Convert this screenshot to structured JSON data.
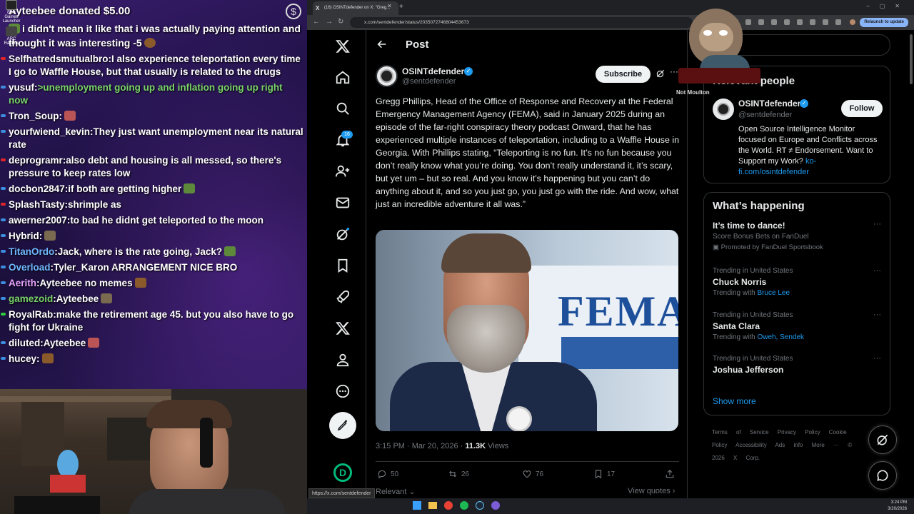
{
  "chat": {
    "donation": {
      "user": "Ayteebee",
      "text": " donated $5.00"
    },
    "donation_message": "i didn't mean it like that i was actually paying attention and thought it was interesting -5",
    "lines": [
      {
        "user": "Selfhatredsmutualbro",
        "sep": ":",
        "text": "I also experience teleportation every time I go to Waffle House, but that usually is related to the drugs",
        "user_color": "#ffffff",
        "dot": "#e0242a",
        "text_color": "#ffffff"
      },
      {
        "user": "yusuf",
        "sep": ":",
        "text": ">unemployment going up and inflation going up right now",
        "user_color": "#ffffff",
        "dot": "#3c8de0",
        "text_color": "#7ad36a"
      },
      {
        "user": "Tron_Soup",
        "sep": ":",
        "text": "",
        "user_color": "#ffffff",
        "dot": "#3c8de0",
        "text_color": "#ffffff"
      },
      {
        "user": "yourfwiend_kevin",
        "sep": ":",
        "text": "They just want unemployment near its natural rate",
        "user_color": "#ffffff",
        "dot": "#3c8de0",
        "text_color": "#ffffff"
      },
      {
        "user": "deprogramr",
        "sep": ":",
        "text": "also debt and housing is all messed, so there's pressure to keep rates low",
        "user_color": "#ffffff",
        "dot": "#e0242a",
        "text_color": "#ffffff"
      },
      {
        "user": "docbon2847",
        "sep": ":",
        "text": "if both are getting higher",
        "user_color": "#ffffff",
        "dot": "#3c8de0",
        "text_color": "#ffffff"
      },
      {
        "user": "SplashTasty",
        "sep": ":",
        "text": "shrimple as",
        "user_color": "#ffffff",
        "dot": "#e0242a",
        "text_color": "#ffffff"
      },
      {
        "user": "awerner2007",
        "sep": ":",
        "text": "to bad he didnt get teleported to the moon",
        "user_color": "#ffffff",
        "dot": "#3c8de0",
        "text_color": "#ffffff"
      },
      {
        "user": "Hybrid",
        "sep": ":",
        "text": "",
        "user_color": "#ffffff",
        "dot": "#3c8de0",
        "text_color": "#ffffff"
      },
      {
        "user": "TitanOrdo",
        "sep": ":",
        "text": "Jack, where is the rate going, Jack?",
        "user_color": "#6fb8ff",
        "dot": "#3c8de0",
        "text_color": "#ffffff"
      },
      {
        "user": "Overload",
        "sep": ":",
        "text": "Tyler_Karon ARRANGEMENT NICE BRO",
        "user_color": "#6fb8ff",
        "dot": "#3c8de0",
        "text_color": "#ffffff"
      },
      {
        "user": "Aerith",
        "sep": ":",
        "text": "Ayteebee",
        "suffix": " no memes",
        "user_color": "#e8a3ff",
        "dot": "#3c8de0",
        "text_color": "#ffffff"
      },
      {
        "user": "gamezoid",
        "sep": ":",
        "text": "Ayteebee",
        "user_color": "#7ad36a",
        "dot": "#3c8de0",
        "text_color": "#ffffff"
      },
      {
        "user": "RoyalRab",
        "sep": ":",
        "text": "make the retirement age 45. but you also have to go fight for Ukraine",
        "user_color": "#ffffff",
        "dot": "#2ecc40",
        "text_color": "#ffffff"
      },
      {
        "user": "diluted",
        "sep": ":",
        "text": "Ayteebee",
        "user_color": "#ffffff",
        "dot": "#3c8de0",
        "text_color": "#ffffff"
      },
      {
        "user": "hucey",
        "sep": ":",
        "text": "",
        "user_color": "#ffffff",
        "dot": "#3c8de0",
        "text_color": "#ffffff"
      }
    ]
  },
  "desktop_icons": [
    "Epic Games Launcher",
    "ARC Raiders"
  ],
  "browser": {
    "tab_title": "(16) OSINTdefender on X: \"Greg...",
    "url": "x.com/sentdefender/status/2035072746804453673",
    "relaunch": "Relaunch to update",
    "status_url": "https://x.com/sentdefender"
  },
  "x_nav": {
    "notification_count": "16"
  },
  "post": {
    "header": "Post",
    "author_name": "OSINTdefender",
    "author_handle": "@sentdefender",
    "subscribe": "Subscribe",
    "text": "Gregg Phillips, Head of the Office of Response and Recovery at the Federal Emergency Management Agency (FEMA), said in January 2025 during an episode of the far-right conspiracy theory podcast Onward, that he has experienced multiple instances of teleportation, including to a Waffle House in Georgia. With Phillips stating, “Teleporting is no fun. It’s no fun because you don’t really know what you’re doing. You don’t really understand it, it’s scary, but yet um – but so real. And you know it’s happening but you can’t do anything about it, and so you just go, you just go with the ride. And wow, what just an incredible adventure it all was.”",
    "image_text": "FEMA",
    "time": "3:15 PM · Mar 20, 2026 · ",
    "views_count": "11.3K",
    "views_label": " Views",
    "replies": "50",
    "reposts": "26",
    "likes": "76",
    "bookmarks": "17",
    "relevant": "Relevant",
    "view_quotes": "View quotes"
  },
  "sidebar": {
    "relevant_title": "Relevant people",
    "person": {
      "name": "OSINTdefender",
      "handle": "@sentdefender",
      "follow": "Follow",
      "bio": "Open Source Intelligence Monitor focused on Europe and Conflicts across the World. RT ≠ Endorsement. Want to Support my Work? ",
      "bio_link": "ko-fi.com/osintdefender"
    },
    "overlay_caption": "Not Moulton",
    "happening_title": "What’s happening",
    "trends": [
      {
        "context": "",
        "name": "It’s time to dance!",
        "sub": "Score Bonus Bets on FanDuel",
        "sub2": "Promoted by FanDuel Sportsbook",
        "link": ""
      },
      {
        "context": "Trending in United States",
        "name": "Chuck Norris",
        "sub": "Trending with ",
        "sub2": "",
        "link": "Bruce Lee"
      },
      {
        "context": "Trending in United States",
        "name": "Santa Clara",
        "sub": "Trending with ",
        "sub2": "",
        "link": "Oweh, Sendek"
      },
      {
        "context": "Trending in United States",
        "name": "Joshua Jefferson",
        "sub": "",
        "sub2": "",
        "link": ""
      }
    ],
    "show_more": "Show more",
    "footer": "Terms of Service Privacy Policy Cookie Policy Accessibility Ads info More ··· © 2026 X Corp."
  },
  "taskbar": {
    "time": "3:24 PM",
    "date": "3/20/2026"
  },
  "colors": {
    "x_blue": "#1d9bf0",
    "chat_bg": "#22134a"
  }
}
